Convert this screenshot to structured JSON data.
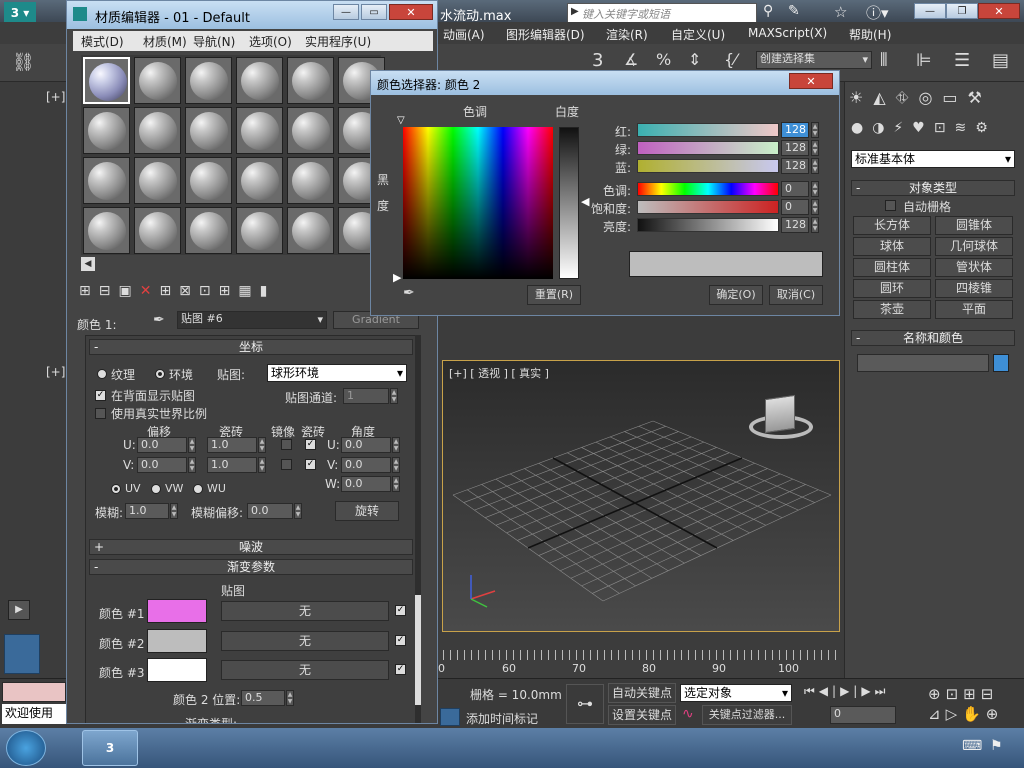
{
  "main": {
    "title_file": "水流动.max",
    "search_placeholder": "键入关键字或短语",
    "menu": [
      "动画(A)",
      "图形编辑器(D)",
      "渲染(R)",
      "自定义(U)",
      "MAXScript(X)",
      "帮助(H)"
    ],
    "selection_set": "创建选择集",
    "viewport_label_top": "[+]",
    "viewport_label_left": "[+]",
    "viewport_persp": "[+] [ 透视 ] [ 真实 ]",
    "ruler_ticks": [
      "0",
      "60",
      "70",
      "80",
      "90",
      "100"
    ],
    "grid_label": "栅格 = 10.0mm",
    "add_time_tag": "添加时间标记",
    "auto_key": "自动关键点",
    "set_key": "设置关键点",
    "selected_object": "选定对象",
    "key_filter": "关键点过滤器...",
    "frame_value": "0",
    "welcome": "欢迎使用"
  },
  "command_panel": {
    "dropdown": "标准基本体",
    "object_type_header": "对象类型",
    "auto_grid": "自动栅格",
    "primitives": [
      "长方体",
      "圆锥体",
      "球体",
      "几何球体",
      "圆柱体",
      "管状体",
      "圆环",
      "四棱锥",
      "茶壶",
      "平面"
    ],
    "name_color_header": "名称和颜色",
    "accent": "#3e8fd6"
  },
  "material_editor": {
    "title": "材质编辑器 - 01 - Default",
    "menu": [
      "模式(D)",
      "材质(M)",
      "导航(N)",
      "选项(O)",
      "实用程序(U)"
    ],
    "color_label": "颜色 1:",
    "map_name": "贴图 #6",
    "map_type": "Gradient",
    "coords_header": "坐标",
    "texture": "纹理",
    "environ": "环境",
    "mapping_label": "贴图:",
    "mapping_value": "球形环境",
    "show_map_back": "在背面显示贴图",
    "real_world": "使用真实世界比例",
    "map_channel_label": "贴图通道:",
    "map_channel": "1",
    "offset": "偏移",
    "tiling": "瓷砖",
    "mirror": "镜像",
    "tile": "瓷砖",
    "angle": "角度",
    "u_offset": "0.0",
    "v_offset": "0.0",
    "u_tiling": "1.0",
    "v_tiling": "1.0",
    "u_angle": "0.0",
    "v_angle": "0.0",
    "w_angle": "0.0",
    "uv": "UV",
    "vw": "VW",
    "wu": "WU",
    "blur_label": "模糊:",
    "blur": "1.0",
    "blur_offset_label": "模糊偏移:",
    "blur_offset": "0.0",
    "rotate": "旋转",
    "noise_header": "噪波",
    "gradient_header": "渐变参数",
    "map_col_header": "贴图",
    "colors": [
      {
        "label": "颜色 #1",
        "swatch": "#e86fe8",
        "map": "无"
      },
      {
        "label": "颜色 #2",
        "swatch": "#bdbdbd",
        "map": "无"
      },
      {
        "label": "颜色 #3",
        "swatch": "#ffffff",
        "map": "无"
      }
    ],
    "color2_pos_label": "颜色 2 位置:",
    "color2_pos": "0.5",
    "grad_type_partial": "渐变类型:"
  },
  "color_picker": {
    "title": "颜色选择器: 颜色 2",
    "hue_label": "色调",
    "white_label": "白度",
    "black_label": "黑度",
    "channels": [
      {
        "label": "红:",
        "value": "128"
      },
      {
        "label": "绿:",
        "value": "128"
      },
      {
        "label": "蓝:",
        "value": "128"
      },
      {
        "label": "色调:",
        "value": "0"
      },
      {
        "label": "饱和度:",
        "value": "0"
      },
      {
        "label": "亮度:",
        "value": "128"
      }
    ],
    "reset": "重置(R)",
    "ok": "确定(O)",
    "cancel": "取消(C)",
    "preview": "#bdbdbd"
  }
}
